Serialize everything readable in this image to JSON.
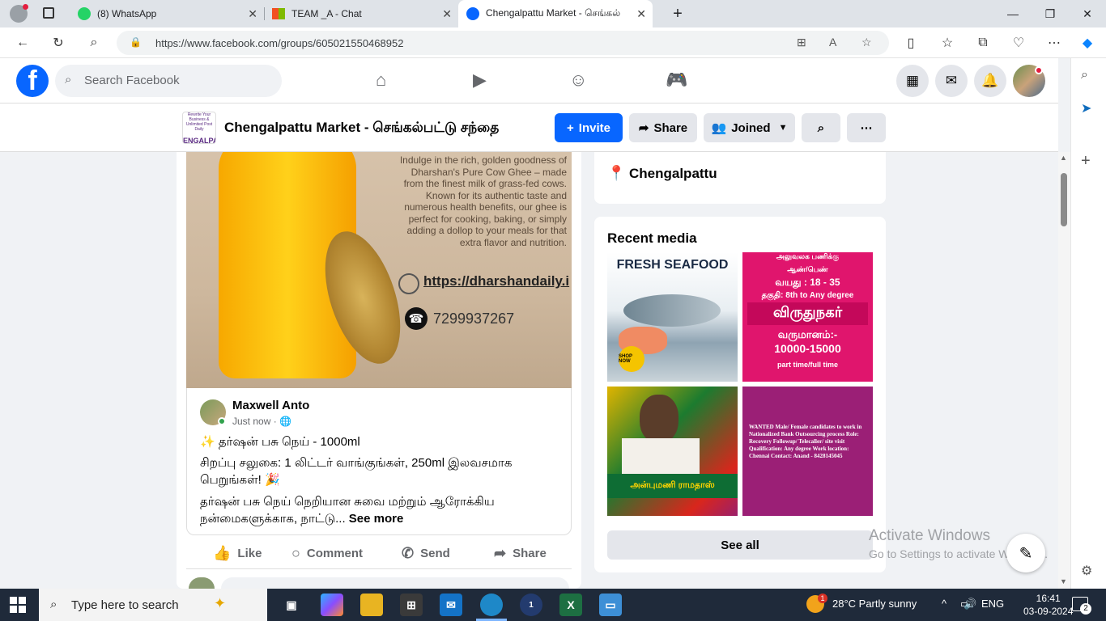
{
  "browser": {
    "tabs": [
      {
        "title": "(8) WhatsApp",
        "active": false
      },
      {
        "title": "TEAM _A - Chat",
        "active": false
      },
      {
        "title": "Chengalpattu Market - செங்கல்",
        "active": true
      }
    ],
    "url": "https://www.facebook.com/groups/605021550468952"
  },
  "fb": {
    "search_placeholder": "Search Facebook",
    "logo_letter": "f"
  },
  "group": {
    "name": "Chengalpattu Market - செங்கல்பட்டு சந்தை",
    "thumb_small": "Rewrite Your Business & Unlimited Post Daily",
    "thumb_big": "ENGALPATTU",
    "buttons": {
      "invite": "Invite",
      "share": "Share",
      "joined": "Joined"
    }
  },
  "ad": {
    "description": "Indulge in the rich, golden goodness of Dharshan's Pure Cow Ghee – made from the finest milk of grass-fed cows. Known for its authentic taste and numerous health benefits, our ghee is perfect for cooking, baking, or simply adding a dollop to your meals for that extra flavor and nutrition.",
    "website": "https://dharshandaily.i",
    "phone": "7299937267"
  },
  "post": {
    "author": "Maxwell Anto",
    "time": "Just now · ",
    "line1": "✨ தர்ஷன் பசு நெய் - 1000ml",
    "line2": "சிறப்பு சலுகை: 1 லிட்டர் வாங்குங்கள், 250ml இலவசமாக பெறுங்கள்! 🎉",
    "line3": "தர்ஷன் பசு நெய் நெறியான சுவை மற்றும் ஆரோக்கிய நன்மைகளுக்காக, நாட்டு... ",
    "see_more": "See more",
    "actions": {
      "like": "Like",
      "comment": "Comment",
      "send": "Send",
      "share": "Share"
    }
  },
  "sidebar": {
    "location": "Chengalpattu",
    "recent_media_title": "Recent media",
    "see_all": "See all",
    "media": {
      "seafood_title": "FRESH SEAFOOD",
      "seafood_shop": "SHOP NOW",
      "job_header": "அலுவலக பணிக்கு",
      "job_gender": "ஆண்/பெண்",
      "job_age": "வயது : 18 - 35",
      "job_qual": "தகுதி: 8th to Any degree",
      "job_city": "விருதுநகர்",
      "job_salary_label": "வருமானம்:-",
      "job_salary": "10000-15000",
      "job_type": "part time/full time",
      "banner_text": "அன்புமணி ராமதாஸ்",
      "bank_text": "WANTED Male/ Female candidates to work in Nationalized Bank Outsourcing process Role: Recovery Followup/ Telecaller/ site visit Qualification: Any degree Work location: Chennai Contact: Anand - 8428145045"
    }
  },
  "watermark": {
    "line1": "Activate Windows",
    "line2": "Go to Settings to activate Windows."
  },
  "taskbar": {
    "search": "Type here to search",
    "weather": "28°C  Partly sunny",
    "lang": "ENG",
    "time": "16:41",
    "date": "03-09-2024",
    "notif_count": "2",
    "weather_badge": "1",
    "app_badge": "1"
  }
}
